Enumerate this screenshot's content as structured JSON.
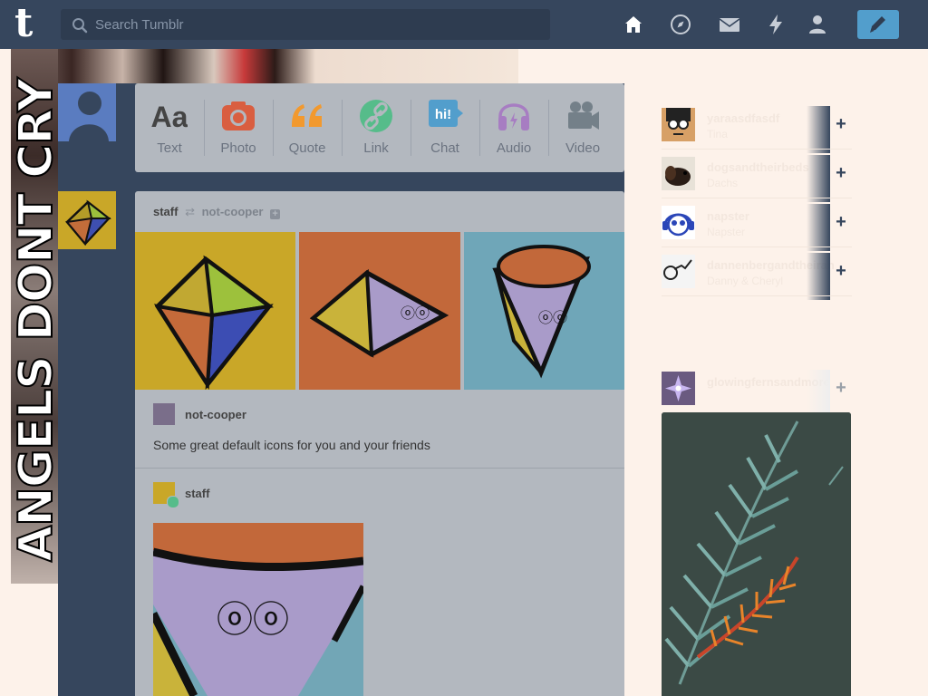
{
  "app": {
    "name": "Tumblr",
    "logo_letter": "t"
  },
  "header": {
    "search_placeholder": "Search Tumblr",
    "nav": [
      "home-icon",
      "compass-icon",
      "mail-icon",
      "lightning-icon",
      "account-icon"
    ],
    "compose_icon": "pencil-icon"
  },
  "background": {
    "vertical_text": "ANGELS DONT CRY"
  },
  "post_types": [
    {
      "label": "Text",
      "icon": "text-aa-icon",
      "color": "#444444"
    },
    {
      "label": "Photo",
      "icon": "camera-icon",
      "color": "#d95e40"
    },
    {
      "label": "Quote",
      "icon": "quote-icon",
      "color": "#f2992e"
    },
    {
      "label": "Link",
      "icon": "link-icon",
      "color": "#56bc8a"
    },
    {
      "label": "Chat",
      "icon": "chat-icon",
      "color": "#529ecc"
    },
    {
      "label": "Audio",
      "icon": "headphones-icon",
      "color": "#a77dc2"
    },
    {
      "label": "Video",
      "icon": "video-camera-icon",
      "color": "#748089"
    }
  ],
  "post": {
    "author": "staff",
    "reblogged_from": "not-cooper",
    "reblog_name": "not-cooper",
    "caption": "Some great default icons for you and your friends",
    "second_author": "staff"
  },
  "sidebar": {
    "recommended": [
      {
        "name": "yaraasdfasdf",
        "sub": "Tina"
      },
      {
        "name": "dogsandtheirbeds",
        "sub": "Dachs"
      },
      {
        "name": "napster",
        "sub": "Napster"
      },
      {
        "name": "dannenbergandtheiran",
        "sub": "Danny & Cheryl"
      }
    ],
    "radar_blog": "glowingfernsandmore"
  },
  "colors": {
    "header_bg": "#36465d",
    "accent": "#529ecc",
    "card": "#b3b8bf"
  }
}
